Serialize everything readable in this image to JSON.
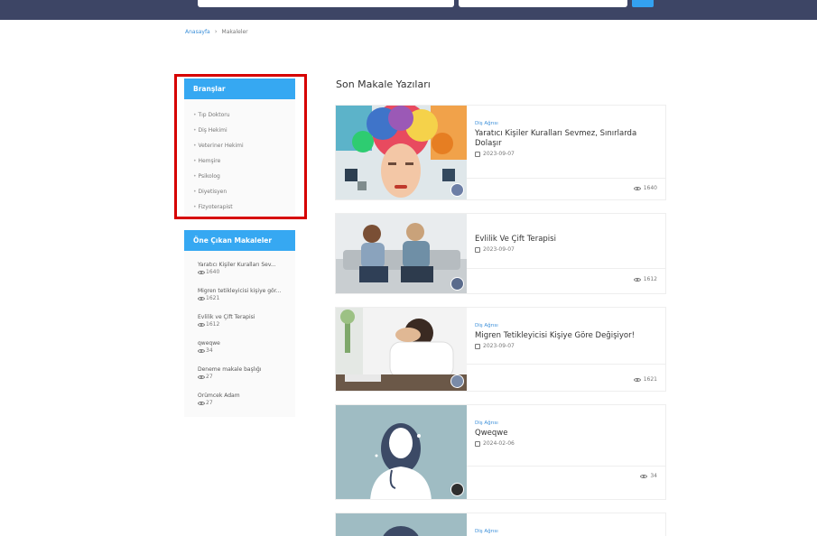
{
  "breadcrumb": {
    "home": "Anasayfa",
    "current": "Makaleler"
  },
  "branches": {
    "title": "Branşlar",
    "items": [
      "Tıp Doktoru",
      "Diş Hekimi",
      "Veteriner Hekimi",
      "Hemşire",
      "Psikolog",
      "Diyetisyen",
      "Fizyoterapist"
    ]
  },
  "featured": {
    "title": "Öne Çıkan Makaleler",
    "items": [
      {
        "title": "Yaratıcı Kişiler Kuralları Sev...",
        "views": "1640"
      },
      {
        "title": "Migren tetikleyicisi kişiye gör...",
        "views": "1621"
      },
      {
        "title": "Evlilik ve Çift Terapisi",
        "views": "1612"
      },
      {
        "title": "qweqwe",
        "views": "34"
      },
      {
        "title": "Deneme makale başlığı",
        "views": "27"
      },
      {
        "title": "Örümcek Adam",
        "views": "27"
      }
    ]
  },
  "main": {
    "section_title": "Son Makale Yazıları",
    "articles": [
      {
        "category": "Diş Ağrısı",
        "title": "Yaratıcı Kişiler Kuralları Sevmez, Sınırlarda Dolaşır",
        "date": "2023-09-07",
        "views": "1640"
      },
      {
        "category": "",
        "title": "Evlilik Ve Çift Terapisi",
        "date": "2023-09-07",
        "views": "1612"
      },
      {
        "category": "Diş Ağrısı",
        "title": "Migren Tetikleyicisi Kişiye Göre Değişiyor!",
        "date": "2023-09-07",
        "views": "1621"
      },
      {
        "category": "Diş Ağrısı",
        "title": "Qweqwe",
        "date": "2024-02-06",
        "views": "34"
      },
      {
        "category": "Diş Ağrısı",
        "title": "",
        "date": "",
        "views": ""
      }
    ]
  },
  "colors": {
    "header": "#3d4565",
    "accent": "#36a8f2",
    "highlight": "#d60000",
    "link": "#3b8fd9"
  }
}
